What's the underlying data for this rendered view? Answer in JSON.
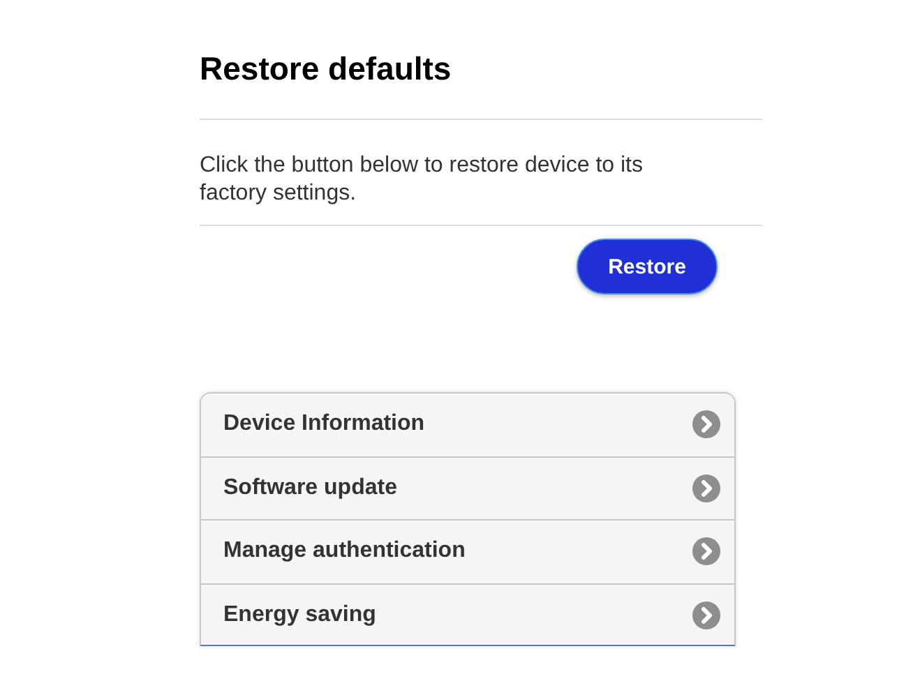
{
  "title": "Restore defaults",
  "description": "Click the button below to restore device to its factory settings.",
  "restore_button": "Restore",
  "menu_items": [
    {
      "label": "Device Information"
    },
    {
      "label": "Software update"
    },
    {
      "label": "Manage authentication"
    },
    {
      "label": "Energy saving"
    }
  ]
}
